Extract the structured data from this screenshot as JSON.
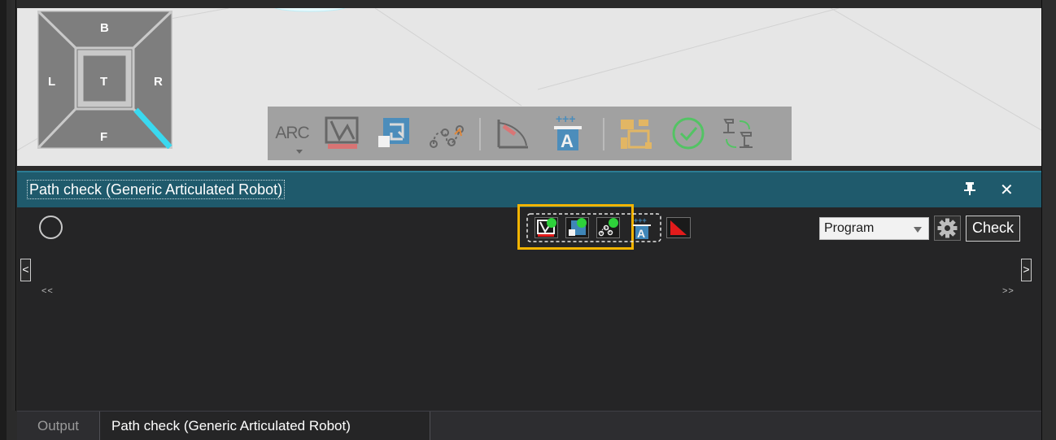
{
  "viewcube": {
    "faces": {
      "back": "B",
      "left": "L",
      "top": "T",
      "right": "R",
      "front": "F"
    }
  },
  "floating_toolbar": {
    "arc_label": "ARC",
    "icons": [
      "project-curve-icon",
      "replace-icon",
      "path-points-icon",
      "angle-icon",
      "text-add-icon",
      "frame-select-icon",
      "check-ok-icon",
      "robot-swap-icon"
    ]
  },
  "panel": {
    "title": "Path check (Generic Articulated Robot)",
    "pin_glyph": "🖈",
    "close_glyph": "✕",
    "scroll_left": "<",
    "scroll_right": ">",
    "nav_prev": "<<",
    "nav_next": ">>",
    "mode_select": {
      "value": "Program"
    },
    "check_label": "Check"
  },
  "tabs": [
    {
      "label": "Output",
      "active": false
    },
    {
      "label": "Path check (Generic Articulated Robot)",
      "active": true
    }
  ],
  "colors": {
    "header": "#1f5a6c",
    "highlight": "#f4b400",
    "accent_cyan": "#3ad9ef",
    "status_green": "#2ed13b",
    "status_red": "#e31b1b"
  }
}
